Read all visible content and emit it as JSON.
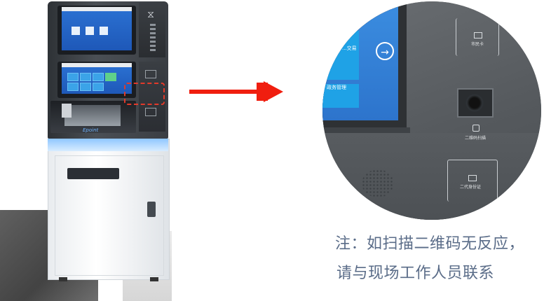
{
  "kiosk": {
    "brand": "Epoint",
    "zoomed_area": "scanner-panel"
  },
  "zoom": {
    "tile_top_label": "...交易",
    "tile_bottom_label": "政务管理",
    "go_button_symbol": "→",
    "card_top_label": "市民卡",
    "scanner_label": "二维码扫描",
    "card_bottom_label": "二代身份证"
  },
  "note": {
    "line1": "注：如扫描二维码无反应，",
    "line2": "请与现场工作人员联系"
  },
  "colors": {
    "arrow": "#f01e0f",
    "highlight": "#e23a2a",
    "note_text": "#5a6c88",
    "screen_blue": "#2d74cc"
  }
}
